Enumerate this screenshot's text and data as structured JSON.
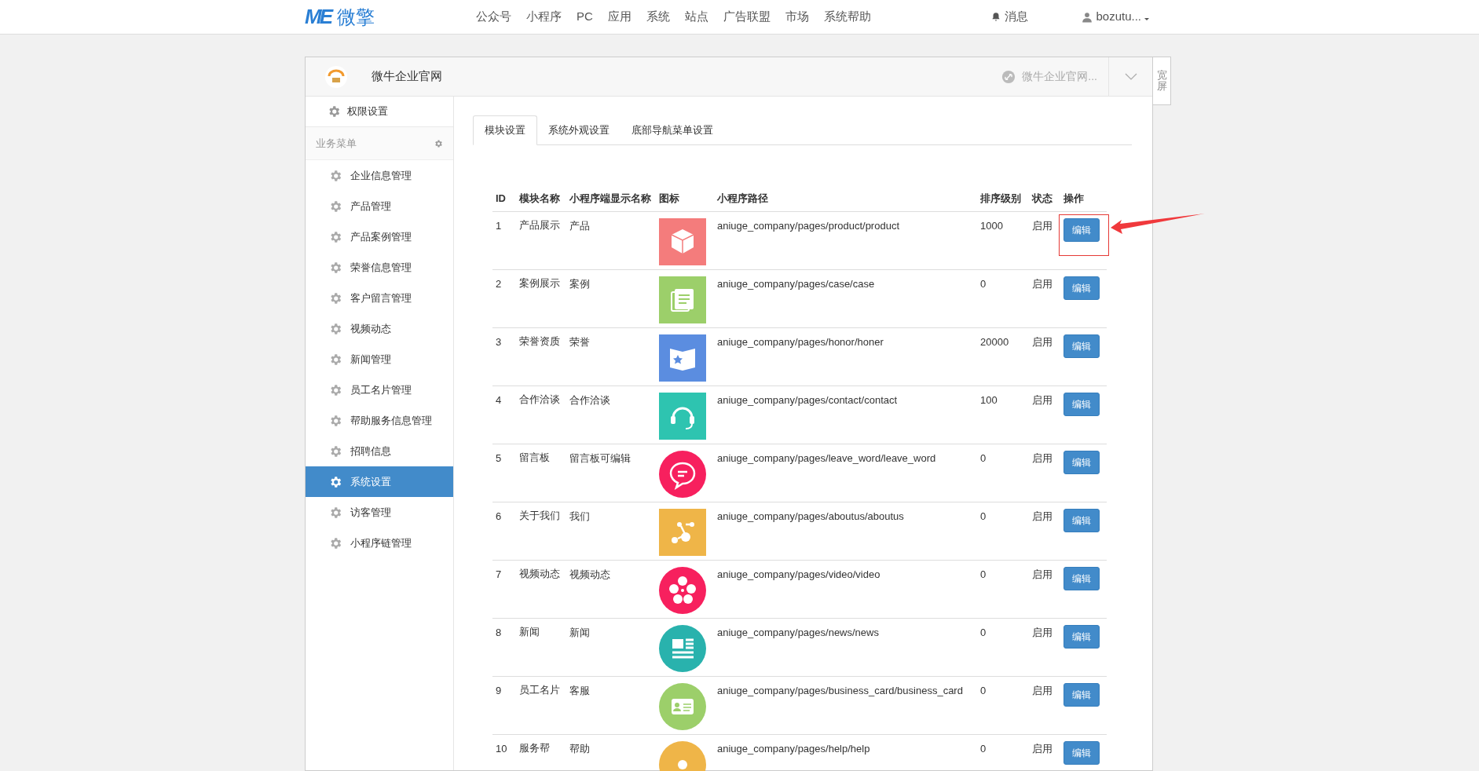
{
  "topbar": {
    "logo_mark": "ME",
    "logo_text": "微擎",
    "nav": [
      "公众号",
      "小程序",
      "PC",
      "应用",
      "系统",
      "站点",
      "广告联盟",
      "市场",
      "系统帮助"
    ],
    "messages": "消息",
    "user": "bozutu..."
  },
  "site_header": {
    "title": "微牛企业官网",
    "switcher": "微牛企业官网...",
    "wide_toggle": "宽屏"
  },
  "sidebar": {
    "top_item": "权限设置",
    "section": "业务菜单",
    "items": [
      {
        "label": "企业信息管理",
        "selected": false
      },
      {
        "label": "产品管理",
        "selected": false
      },
      {
        "label": "产品案例管理",
        "selected": false
      },
      {
        "label": "荣誉信息管理",
        "selected": false
      },
      {
        "label": "客户留言管理",
        "selected": false
      },
      {
        "label": "视频动态",
        "selected": false
      },
      {
        "label": "新闻管理",
        "selected": false
      },
      {
        "label": "员工名片管理",
        "selected": false
      },
      {
        "label": "帮助服务信息管理",
        "selected": false
      },
      {
        "label": "招聘信息",
        "selected": false
      },
      {
        "label": "系统设置",
        "selected": true
      },
      {
        "label": "访客管理",
        "selected": false
      },
      {
        "label": "小程序链管理",
        "selected": false
      }
    ]
  },
  "tabs": [
    {
      "label": "模块设置",
      "selected": true
    },
    {
      "label": "系统外观设置",
      "selected": false
    },
    {
      "label": "底部导航菜单设置",
      "selected": false
    }
  ],
  "table": {
    "columns": [
      "ID",
      "模块名称",
      "小程序端显示名称",
      "图标",
      "小程序路径",
      "排序级别",
      "状态",
      "操作"
    ],
    "rows": [
      {
        "id": "1",
        "name": "产品展示",
        "display": "产品",
        "icon": {
          "kind": "square",
          "color": "#f47c7c"
        },
        "path": "aniuge_company/pages/product/product",
        "sort": "1000",
        "status": "启用",
        "action": "编辑",
        "annotated": true
      },
      {
        "id": "2",
        "name": "案例展示",
        "display": "案例",
        "icon": {
          "kind": "square",
          "color": "#9ccf6a"
        },
        "path": "aniuge_company/pages/case/case",
        "sort": "0",
        "status": "启用",
        "action": "编辑",
        "annotated": false
      },
      {
        "id": "3",
        "name": "荣誉资质",
        "display": "荣誉",
        "icon": {
          "kind": "square",
          "color": "#5b8de0"
        },
        "path": "aniuge_company/pages/honor/honer",
        "sort": "20000",
        "status": "启用",
        "action": "编辑",
        "annotated": false
      },
      {
        "id": "4",
        "name": "合作洽谈",
        "display": "合作洽谈",
        "icon": {
          "kind": "square",
          "color": "#2ec4b0"
        },
        "path": "aniuge_company/pages/contact/contact",
        "sort": "100",
        "status": "启用",
        "action": "编辑",
        "annotated": false
      },
      {
        "id": "5",
        "name": "留言板",
        "display": "留言板可编辑",
        "icon": {
          "kind": "circle",
          "color": "#f7205e"
        },
        "path": "aniuge_company/pages/leave_word/leave_word",
        "sort": "0",
        "status": "启用",
        "action": "编辑",
        "annotated": false
      },
      {
        "id": "6",
        "name": "关于我们",
        "display": "我们",
        "icon": {
          "kind": "square",
          "color": "#efb548"
        },
        "path": "aniuge_company/pages/aboutus/aboutus",
        "sort": "0",
        "status": "启用",
        "action": "编辑",
        "annotated": false
      },
      {
        "id": "7",
        "name": "视频动态",
        "display": "视频动态",
        "icon": {
          "kind": "circle",
          "color": "#f7205e"
        },
        "path": "aniuge_company/pages/video/video",
        "sort": "0",
        "status": "启用",
        "action": "编辑",
        "annotated": false
      },
      {
        "id": "8",
        "name": "新闻",
        "display": "新闻",
        "icon": {
          "kind": "circle",
          "color": "#29b2ad"
        },
        "path": "aniuge_company/pages/news/news",
        "sort": "0",
        "status": "启用",
        "action": "编辑",
        "annotated": false
      },
      {
        "id": "9",
        "name": "员工名片",
        "display": "客服",
        "icon": {
          "kind": "circle",
          "color": "#9ccf6a"
        },
        "path": "aniuge_company/pages/business_card/business_card",
        "sort": "0",
        "status": "启用",
        "action": "编辑",
        "annotated": false
      },
      {
        "id": "10",
        "name": "服务帮",
        "display": "帮助",
        "icon": {
          "kind": "circle",
          "color": "#efb548"
        },
        "path": "aniuge_company/pages/help/help",
        "sort": "0",
        "status": "启用",
        "action": "编辑",
        "annotated": false
      }
    ]
  }
}
